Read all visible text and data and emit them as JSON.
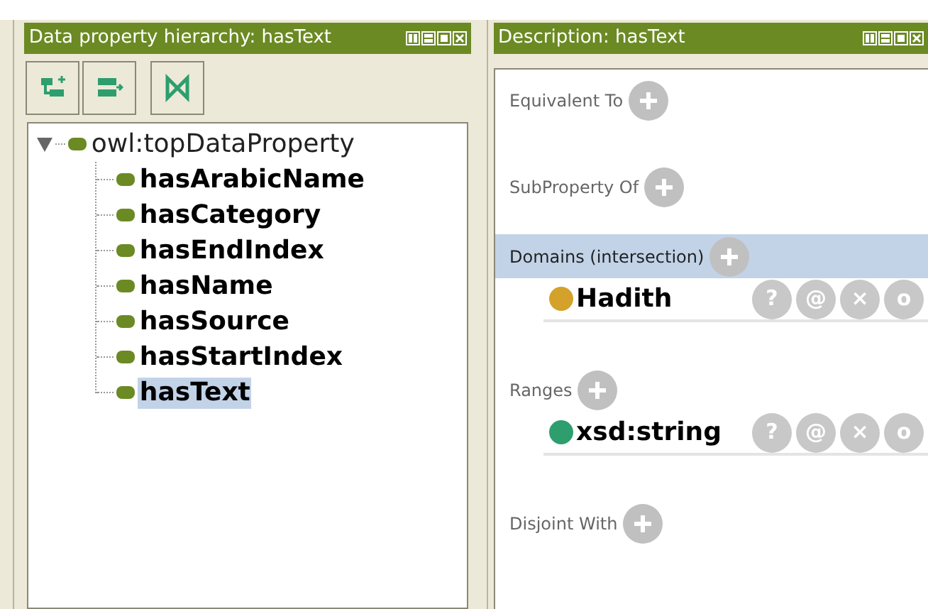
{
  "hierarchy_panel": {
    "title": "Data property hierarchy: hasText",
    "tree": {
      "label": "owl:topDataProperty",
      "expanded": true,
      "selected": false,
      "children": [
        {
          "label": "hasArabicName",
          "selected": false
        },
        {
          "label": "hasCategory",
          "selected": false
        },
        {
          "label": "hasEndIndex",
          "selected": false
        },
        {
          "label": "hasName",
          "selected": false
        },
        {
          "label": "hasSource",
          "selected": false
        },
        {
          "label": "hasStartIndex",
          "selected": false
        },
        {
          "label": "hasText",
          "selected": true
        }
      ]
    }
  },
  "description_panel": {
    "title": "Description: hasText",
    "sections": [
      {
        "header": "Equivalent To",
        "selected": false
      },
      {
        "header": "SubProperty Of",
        "selected": false
      },
      {
        "header": "Domains (intersection)",
        "selected": true,
        "items": [
          {
            "name": "Hadith",
            "color": "#d4a22a",
            "buttons": [
              "?",
              "@",
              "×",
              "o"
            ]
          }
        ]
      },
      {
        "header": "Ranges",
        "selected": false,
        "items": [
          {
            "name": "xsd:string",
            "color": "#2e9e6e",
            "buttons": [
              "?",
              "@",
              "×",
              "o"
            ]
          }
        ]
      },
      {
        "header": "Disjoint With",
        "selected": false
      }
    ]
  }
}
